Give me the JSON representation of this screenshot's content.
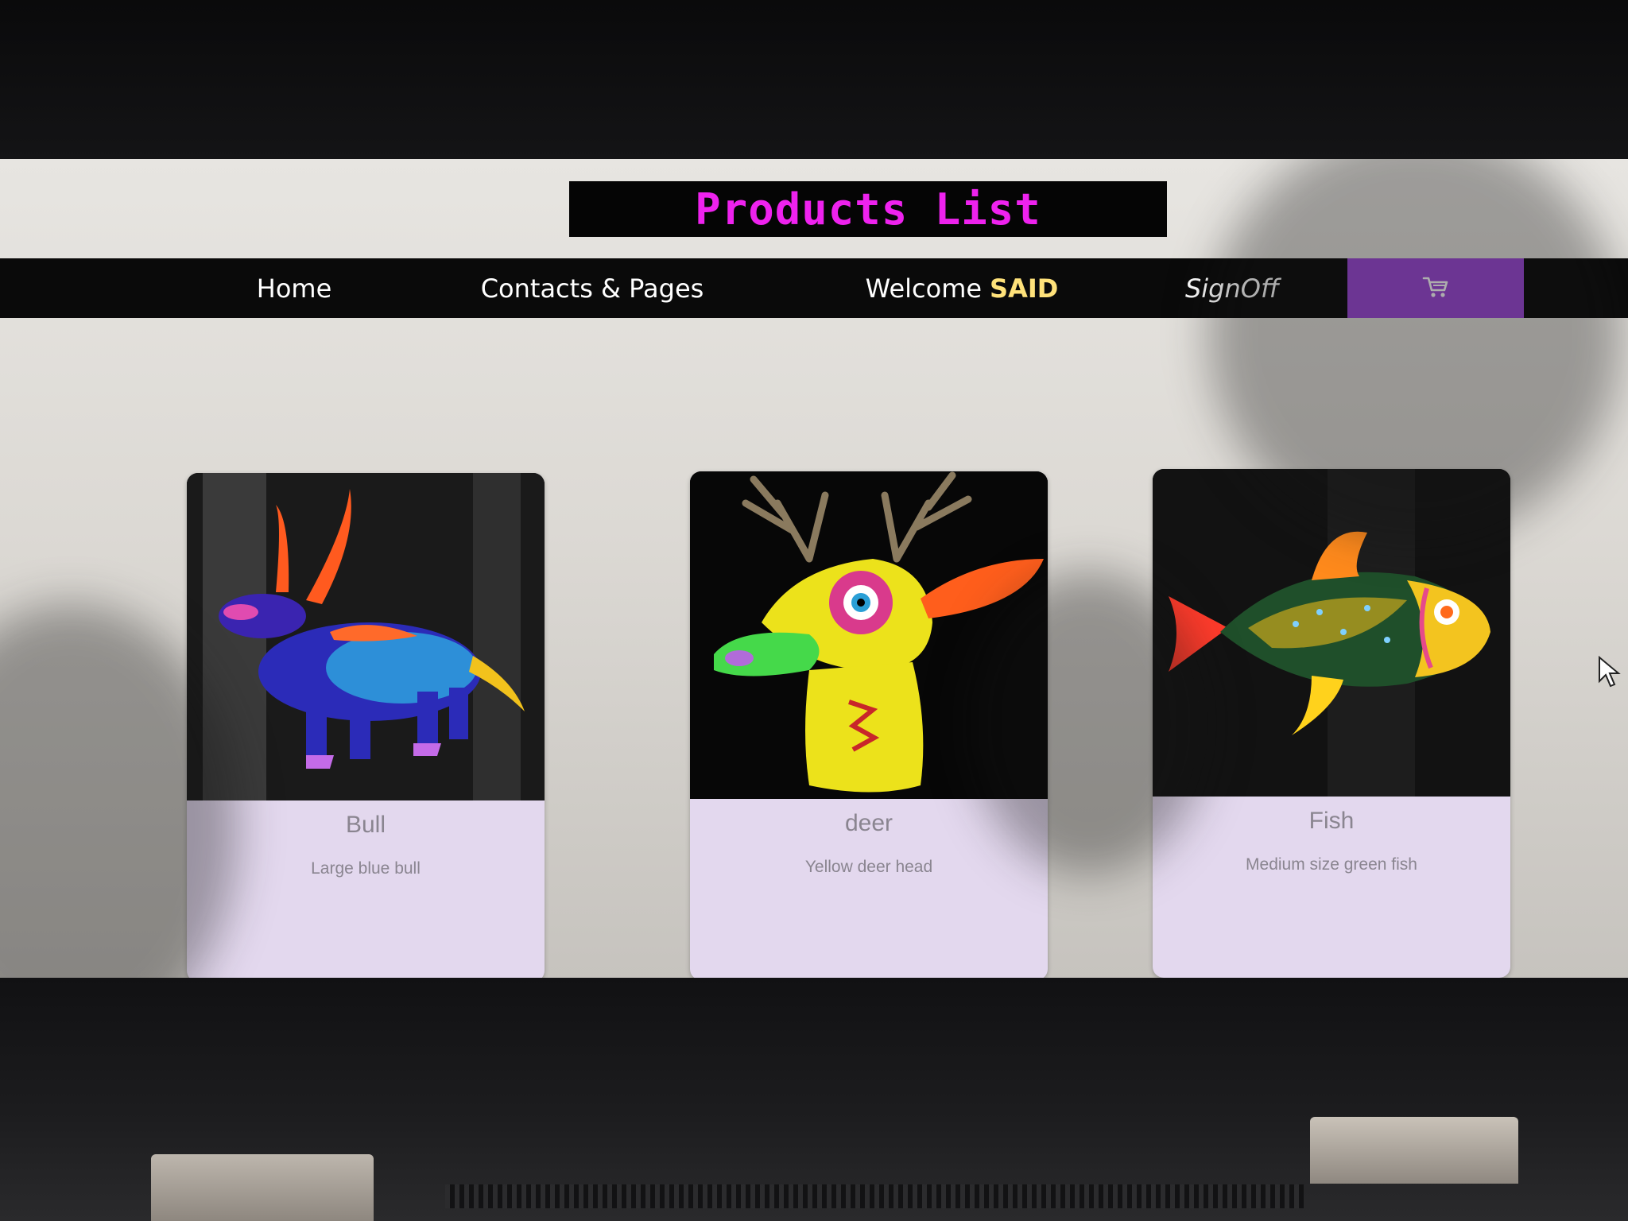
{
  "page": {
    "title": "Products List"
  },
  "nav": {
    "home": "Home",
    "contacts": "Contacts & Pages",
    "welcome_prefix": "Welcome",
    "welcome_user": "SAID",
    "signoff": "SignOff",
    "cart_icon": "shopping-cart-icon"
  },
  "products": [
    {
      "name": "Bull",
      "description": "Large blue bull",
      "image": "bull-figurine-image"
    },
    {
      "name": "deer",
      "description": "Yellow deer head",
      "image": "deer-head-figurine-image"
    },
    {
      "name": "Fish",
      "description": "Medium size green fish",
      "image": "fish-figurine-image"
    }
  ],
  "colors": {
    "title_bg": "#050505",
    "title_text": "#ee22ee",
    "navbar_bg": "#0a0a0a",
    "cart_bg": "#9b47d8",
    "welcome_user": "#ffe27a",
    "card_bg": "#e3d8ee"
  }
}
